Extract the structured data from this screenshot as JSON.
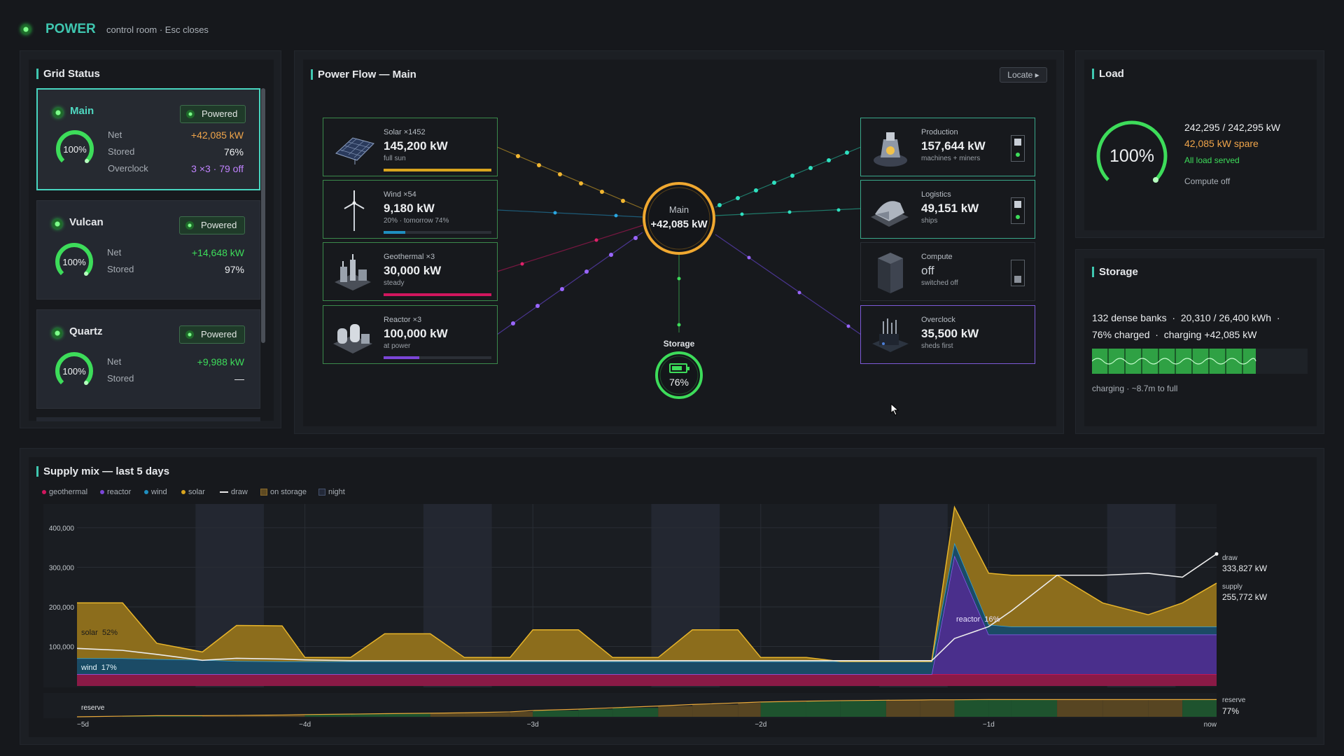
{
  "header": {
    "title": "POWER",
    "subtitle": "control room · Esc closes"
  },
  "grid_status": {
    "title": "Grid Status",
    "grids": [
      {
        "name": "Main",
        "status": "Powered",
        "gauge": "100%",
        "net_label": "Net",
        "net": "+42,085 kW",
        "stored_label": "Stored",
        "stored": "76%",
        "overclock_label": "Overclock",
        "overclock": "3 ×3 · 79 off"
      },
      {
        "name": "Vulcan",
        "status": "Powered",
        "gauge": "100%",
        "net_label": "Net",
        "net": "+14,648 kW",
        "stored_label": "Stored",
        "stored": "97%"
      },
      {
        "name": "Quartz",
        "status": "Powered",
        "gauge": "100%",
        "net_label": "Net",
        "net": "+9,988 kW",
        "stored_label": "Stored",
        "stored": "—"
      }
    ]
  },
  "power_flow": {
    "title": "Power Flow — Main",
    "locate_label": "Locate ▸",
    "hub_label": "Main",
    "hub_value": "+42,085 kW",
    "storage_label": "Storage",
    "storage_value": "76%",
    "sources": [
      {
        "title": "Solar ×1452",
        "value": "145,200 kW",
        "sub": "full sun",
        "bar_color": "#d9a41e",
        "bar_fill": 1.0
      },
      {
        "title": "Wind ×54",
        "value": "9,180 kW",
        "sub": "20% · tomorrow 74%",
        "bar_color": "#1f8fc0",
        "bar_fill": 0.2
      },
      {
        "title": "Geothermal ×3",
        "value": "30,000 kW",
        "sub": "steady",
        "bar_color": "#d1165e",
        "bar_fill": 1.0
      },
      {
        "title": "Reactor ×3",
        "value": "100,000 kW",
        "sub": "at power",
        "bar_color": "#7b46d8",
        "bar_fill": 0.33
      }
    ],
    "consumers": [
      {
        "title": "Production",
        "value": "157,644 kW",
        "sub": "machines + miners",
        "switch": "on"
      },
      {
        "title": "Logistics",
        "value": "49,151 kW",
        "sub": "ships",
        "switch": "on"
      },
      {
        "title": "Compute",
        "value": "off",
        "sub": "switched off",
        "switch": "off"
      },
      {
        "title": "Overclock",
        "value": "35,500 kW",
        "sub": "sheds first"
      }
    ]
  },
  "load": {
    "title": "Load",
    "gauge": "100%",
    "line1": "242,295 / 242,295 kW",
    "line2": "42,085 kW spare",
    "line3": "All load served",
    "line4": "Compute off"
  },
  "storage": {
    "title": "Storage",
    "line1": "132 dense banks  ·  20,310 / 26,400 kWh  ·",
    "line2": "76% charged  ·  charging +42,085 kW",
    "charge_fraction": 0.76,
    "footer": "charging · ~8.7m to full"
  },
  "supply_mix": {
    "title": "Supply mix — last 5 days",
    "legend": [
      {
        "label": "geothermal",
        "color": "#d1165e"
      },
      {
        "label": "reactor",
        "color": "#7b46d8"
      },
      {
        "label": "wind",
        "color": "#1f8fc0"
      },
      {
        "label": "solar",
        "color": "#d9a41e"
      },
      {
        "label": "draw",
        "color": "#e8e8e8"
      },
      {
        "label": "on storage",
        "color": "#8a6a2a"
      },
      {
        "label": "night",
        "color": "#44506a"
      }
    ],
    "area_labels": {
      "solar": "solar  52%",
      "wind": "wind  17%",
      "reactor": "reactor  16%"
    },
    "right_labels": {
      "draw_name": "draw",
      "draw_value": "333,827 kW",
      "supply_name": "supply",
      "supply_value": "255,772 kW",
      "reserve_name": "reserve",
      "reserve_value": "77%"
    },
    "reserve_label": "reserve"
  },
  "chart_data": {
    "type": "area",
    "title": "Supply mix — last 5 days",
    "x_tick_labels": [
      "−5d",
      "−4d",
      "−3d",
      "−2d",
      "−1d",
      "now"
    ],
    "y_tick_labels": [
      "100,000",
      "200,000",
      "300,000",
      "400,000"
    ],
    "ylim": [
      0,
      460000
    ],
    "x": [
      0,
      0.2,
      0.35,
      0.55,
      0.7,
      0.9,
      1.0,
      1.2,
      1.35,
      1.55,
      1.7,
      1.9,
      2.0,
      2.2,
      2.35,
      2.55,
      2.7,
      2.9,
      3.0,
      3.2,
      3.35,
      3.55,
      3.7,
      3.75,
      3.85,
      4.0,
      4.1,
      4.3,
      4.5,
      4.7,
      4.85,
      5.0
    ],
    "series": [
      {
        "name": "geothermal",
        "values": [
          30000,
          30000,
          30000,
          30000,
          30000,
          30000,
          30000,
          30000,
          30000,
          30000,
          30000,
          30000,
          30000,
          30000,
          30000,
          30000,
          30000,
          30000,
          30000,
          30000,
          30000,
          30000,
          30000,
          30000,
          30000,
          30000,
          30000,
          30000,
          30000,
          30000,
          30000,
          30000
        ]
      },
      {
        "name": "reactor",
        "values": [
          0,
          0,
          0,
          0,
          0,
          0,
          0,
          0,
          0,
          0,
          0,
          0,
          0,
          0,
          0,
          0,
          0,
          0,
          0,
          0,
          0,
          0,
          0,
          0,
          300000,
          100000,
          100000,
          100000,
          100000,
          100000,
          100000,
          100000
        ]
      },
      {
        "name": "wind",
        "values": [
          40000,
          40000,
          38000,
          36000,
          33000,
          32000,
          32000,
          32000,
          32000,
          32000,
          32000,
          32000,
          32000,
          32000,
          32000,
          32000,
          32000,
          32000,
          32000,
          32000,
          32000,
          32000,
          32000,
          32000,
          32000,
          25000,
          20000,
          20000,
          20000,
          20000,
          20000,
          20000
        ]
      },
      {
        "name": "solar",
        "values": [
          140000,
          140000,
          40000,
          20000,
          90000,
          90000,
          10000,
          10000,
          70000,
          70000,
          10000,
          10000,
          80000,
          80000,
          10000,
          10000,
          80000,
          80000,
          10000,
          10000,
          0,
          0,
          0,
          0,
          90000,
          130000,
          130000,
          130000,
          60000,
          30000,
          60000,
          110000
        ]
      }
    ],
    "draw": [
      95000,
      90000,
      80000,
      65000,
      70000,
      68000,
      66000,
      64000,
      64000,
      64000,
      64000,
      64000,
      64000,
      64000,
      64000,
      64000,
      64000,
      64000,
      64000,
      64000,
      64000,
      64000,
      64000,
      64000,
      120000,
      150000,
      190000,
      280000,
      280000,
      285000,
      275000,
      333827
    ],
    "reserve_pct": [
      0,
      3,
      5,
      5,
      6,
      8,
      10,
      12,
      14,
      16,
      18,
      22,
      28,
      34,
      40,
      48,
      55,
      62,
      66,
      70,
      72,
      74,
      75,
      76,
      76,
      77,
      77,
      77,
      77,
      77,
      77,
      77
    ],
    "night_bands": [
      [
        0.52,
        0.82
      ],
      [
        1.52,
        1.82
      ],
      [
        2.52,
        2.82
      ],
      [
        3.52,
        3.82
      ],
      [
        4.52,
        4.82
      ]
    ]
  }
}
